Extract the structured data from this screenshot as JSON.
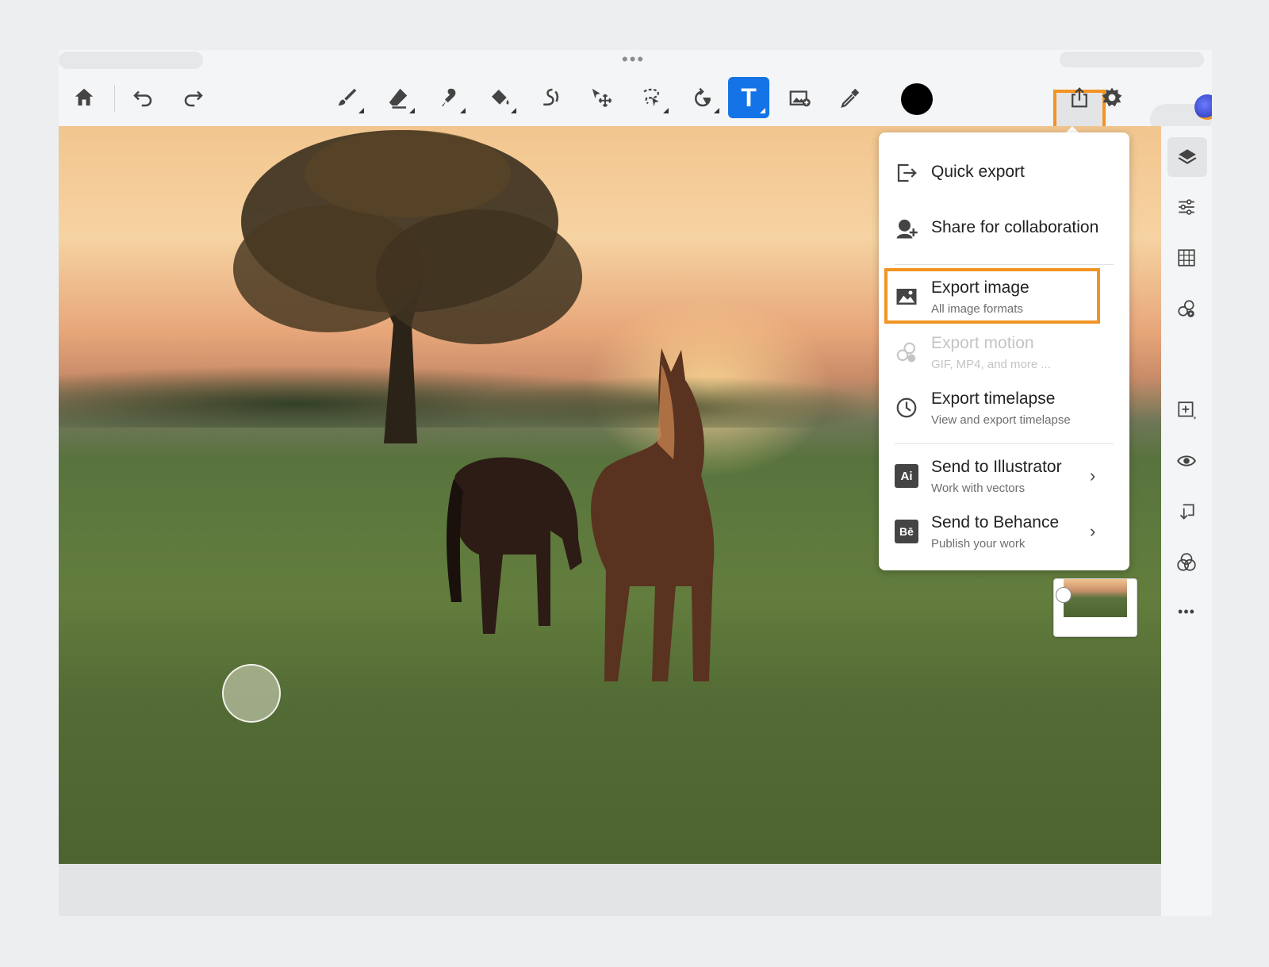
{
  "toolbar": {
    "tools": [
      {
        "name": "home-icon"
      },
      {
        "name": "undo-icon"
      },
      {
        "name": "redo-icon"
      },
      {
        "name": "brush-icon"
      },
      {
        "name": "eraser-icon"
      },
      {
        "name": "smudge-icon"
      },
      {
        "name": "paint-bucket-icon"
      },
      {
        "name": "healing-icon"
      },
      {
        "name": "move-icon"
      },
      {
        "name": "lasso-select-icon"
      },
      {
        "name": "transform-icon"
      },
      {
        "name": "text-icon",
        "active": true
      },
      {
        "name": "place-image-icon"
      },
      {
        "name": "eyedropper-icon"
      }
    ],
    "current_color": "#000000",
    "share_icon": "share-icon",
    "settings_icon": "gear-icon",
    "text_tool_glyph": "T"
  },
  "export_menu": {
    "items": [
      {
        "title": "Quick export",
        "subtitle": "",
        "icon": "quick-export-icon"
      },
      {
        "title": "Share for collaboration",
        "subtitle": "",
        "icon": "invite-icon"
      },
      {
        "title": "Export image",
        "subtitle": "All image formats",
        "icon": "image-icon",
        "highlighted": true
      },
      {
        "title": "Export motion",
        "subtitle": "GIF, MP4, and more ...",
        "icon": "motion-icon",
        "disabled": true
      },
      {
        "title": "Export timelapse",
        "subtitle": "View and export timelapse",
        "icon": "clock-icon"
      },
      {
        "title": "Send to Illustrator",
        "subtitle": "Work with vectors",
        "icon": "illustrator-icon",
        "badge": "Ai"
      },
      {
        "title": "Send to Behance",
        "subtitle": "Publish your work",
        "icon": "behance-icon",
        "badge": "Bē"
      }
    ],
    "chevron": "›"
  },
  "right_panel": {
    "items": [
      "layers-icon",
      "adjustments-icon",
      "grid-icon",
      "motion-icon",
      "add-layer-icon",
      "visibility-icon",
      "merge-down-icon",
      "blend-icon",
      "more-icon"
    ],
    "more_glyph": "•••"
  },
  "colors": {
    "accent": "#1473e6",
    "highlight": "#f29423"
  }
}
